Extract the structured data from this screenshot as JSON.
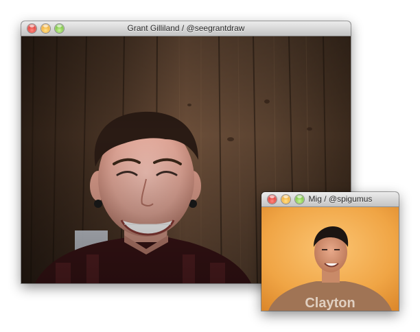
{
  "windows": {
    "main": {
      "title": "Grant Gilliland / @seegrantdraw"
    },
    "small": {
      "title": "Mig / @spigumus",
      "shirt_text": "Clayton"
    }
  },
  "colors": {
    "wall_wood": "#3a2a1e",
    "orange_wall": "#f0a545",
    "shirt_flannel": "#3a1416",
    "shirt_tan": "#a07455"
  },
  "icons": [
    "close-icon",
    "minimize-icon",
    "zoom-icon"
  ]
}
